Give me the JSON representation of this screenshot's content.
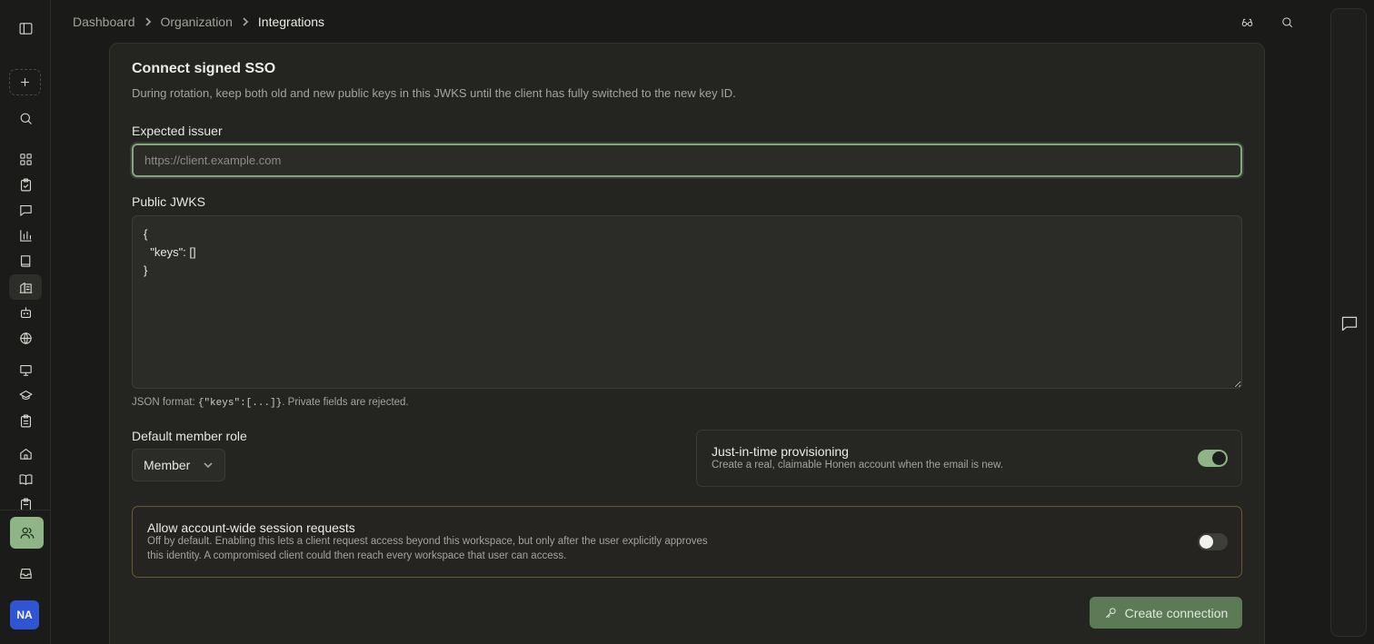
{
  "breadcrumb": {
    "items": [
      "Dashboard",
      "Organization"
    ],
    "current": "Integrations"
  },
  "rail": {
    "avatar_initials": "NA",
    "icons": [
      "sidebar-toggle-icon",
      "plus-icon",
      "search-icon",
      "dashboard-icon",
      "clipboard-check-icon",
      "chat-icon",
      "bar-chart-icon",
      "book-icon",
      "building-icon",
      "bot-icon",
      "globe-icon",
      "presentation-icon",
      "graduation-cap-icon",
      "clipboard-list-icon",
      "home-icon",
      "book-open-icon",
      "clipboard-icon",
      "users-icon",
      "inbox-icon"
    ]
  },
  "form": {
    "title": "Connect signed SSO",
    "description": "During rotation, keep both old and new public keys in this JWKS until the client has fully switched to the new key ID.",
    "issuer_label": "Expected issuer",
    "issuer_placeholder": "https://client.example.com",
    "issuer_value": "",
    "jwks_label": "Public JWKS",
    "jwks_value": "{\n  \"keys\": []\n}",
    "helper_prefix": "JSON format: ",
    "helper_code": "{\"keys\":[...]}",
    "helper_suffix": ". Private fields are rejected.",
    "role_label": "Default member role",
    "role_value": "Member",
    "jit": {
      "title": "Just-in-time provisioning",
      "description": "Create a real, claimable Honen account when the email is new.",
      "enabled": true
    },
    "session": {
      "title": "Allow account-wide session requests",
      "description_line1": "Off by default. Enabling this lets a client request access beyond this workspace, but only after the user explicitly approves",
      "description_line2": "this identity. A compromised client could then reach every workspace that user can access.",
      "enabled": false
    },
    "submit_label": "Create connection"
  },
  "colors": {
    "accent": "#8fb486",
    "button": "#5c7a56",
    "warning_border": "#6a5a33",
    "avatar": "#2f55d4"
  }
}
